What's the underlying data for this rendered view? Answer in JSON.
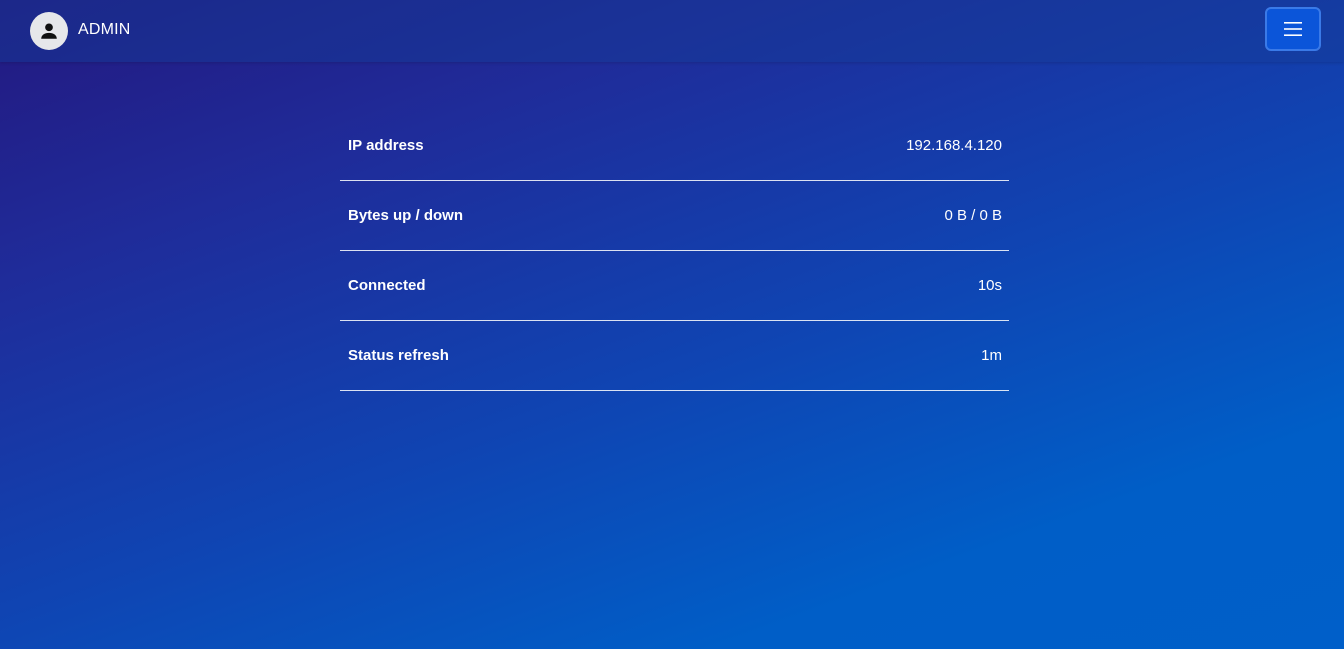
{
  "header": {
    "username": "ADMIN",
    "avatar_icon": "user-icon",
    "menu_icon": "hamburger-menu-icon"
  },
  "status": {
    "rows": [
      {
        "label": "IP address",
        "value": "192.168.4.120"
      },
      {
        "label": "Bytes up / down",
        "value": "0 B / 0 B"
      },
      {
        "label": "Connected",
        "value": "10s"
      },
      {
        "label": "Status refresh",
        "value": "1m"
      }
    ]
  },
  "colors": {
    "background_top_left": "#23187f",
    "background_bottom_right": "#005fc9",
    "menu_button": "#0b55d9",
    "text": "#ffffff"
  }
}
